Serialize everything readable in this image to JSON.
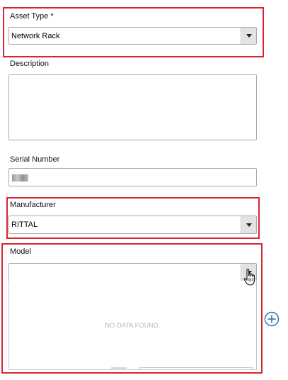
{
  "asset_type": {
    "label": "Asset Type *",
    "value": "Network Rack"
  },
  "description": {
    "label": "Description",
    "value": ""
  },
  "serial_number": {
    "label": "Serial Number"
  },
  "manufacturer": {
    "label": "Manufacturer",
    "value": "RITTAL"
  },
  "model": {
    "label": "Model",
    "value": "",
    "empty_message": "NO DATA FOUND."
  },
  "icons": {
    "add": "plus-circle-icon",
    "cursor": "hand-pointer-icon",
    "dropdown": "caret-down-icon"
  },
  "colors": {
    "highlight": "#d7262e",
    "border": "#a9a9a9",
    "button_bg": "#e3e3e3",
    "add_icon": "#2f6fb0"
  }
}
